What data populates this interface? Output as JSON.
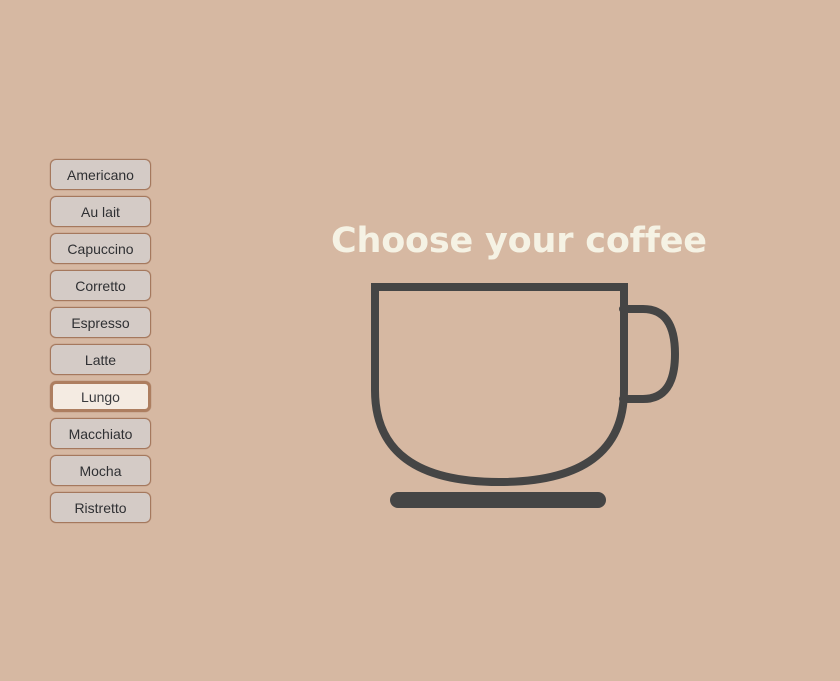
{
  "page": {
    "background_color": "#d6b8a2",
    "title": "Choose your coffee",
    "title_color": "#f5f2e4"
  },
  "coffee_list": {
    "selected": "Lungo",
    "selected_background": "#f4ebe2",
    "selected_border_color": "#ad7e60",
    "item_background": "#d4cbc6",
    "item_border_color": "#a5785d",
    "items": [
      {
        "label": "Americano",
        "selected": false
      },
      {
        "label": "Au lait",
        "selected": false
      },
      {
        "label": "Capuccino",
        "selected": false
      },
      {
        "label": "Corretto",
        "selected": false
      },
      {
        "label": "Espresso",
        "selected": false
      },
      {
        "label": "Latte",
        "selected": false
      },
      {
        "label": "Lungo",
        "selected": true
      },
      {
        "label": "Macchiato",
        "selected": false
      },
      {
        "label": "Mocha",
        "selected": false
      },
      {
        "label": "Ristretto",
        "selected": false
      }
    ]
  },
  "illustration": {
    "name": "coffee-cup-icon",
    "stroke_color": "#454545",
    "stroke_width": 8,
    "parts": [
      "cup-body",
      "cup-handle",
      "saucer-bar"
    ]
  }
}
